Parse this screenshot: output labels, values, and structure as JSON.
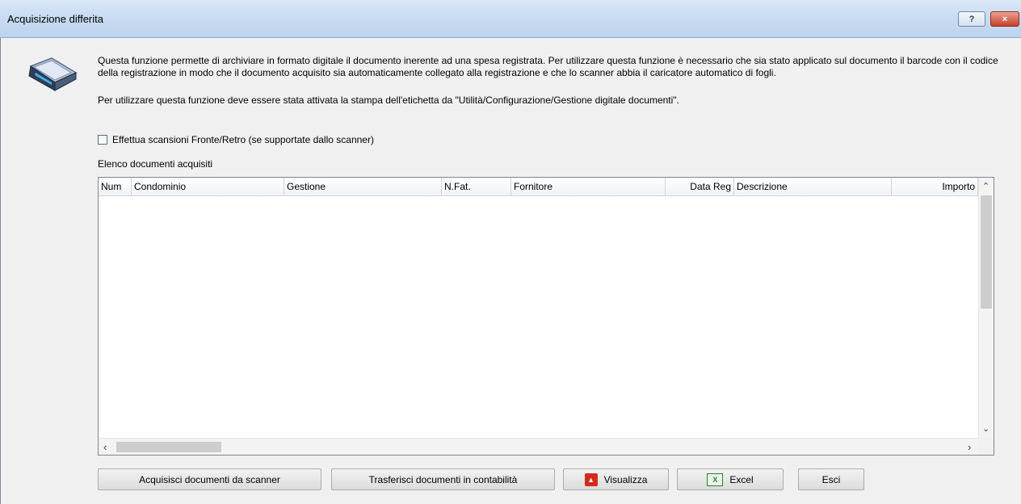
{
  "window": {
    "title": "Acquisizione differita",
    "help_label": "?",
    "close_label": "×"
  },
  "intro": {
    "paragraph1": "Questa funzione permette di archiviare in formato digitale il documento inerente ad una spesa registrata. Per utilizzare questa funzione è necessario che sia stato applicato sul documento il barcode con il codice della registrazione in modo che il documento acquisito sia automaticamente collegato alla registrazione e che lo scanner abbia il caricatore automatico di fogli.",
    "paragraph2": "Per utilizzare questa funzione deve essere stata attivata la stampa dell'etichetta da \"Utilità/Configurazione/Gestione digitale documenti\"."
  },
  "options": {
    "duplex_label": "Effettua scansioni Fronte/Retro (se supportate dallo scanner)",
    "duplex_checked": false
  },
  "list": {
    "label": "Elenco documenti acquisiti",
    "columns": [
      "Num",
      "Condominio",
      "Gestione",
      "N.Fat.",
      "Fornitore",
      "Data Reg",
      "Descrizione",
      "Importo"
    ],
    "rows": []
  },
  "buttons": {
    "acquire": "Acquisisci documenti da scanner",
    "transfer": "Trasferisci documenti in contabilità",
    "view": "Visualizza",
    "excel": "Excel",
    "exit": "Esci"
  },
  "icons": {
    "scanner": "scanner-icon",
    "pdf": "pdf-icon",
    "excel": "excel-icon"
  }
}
